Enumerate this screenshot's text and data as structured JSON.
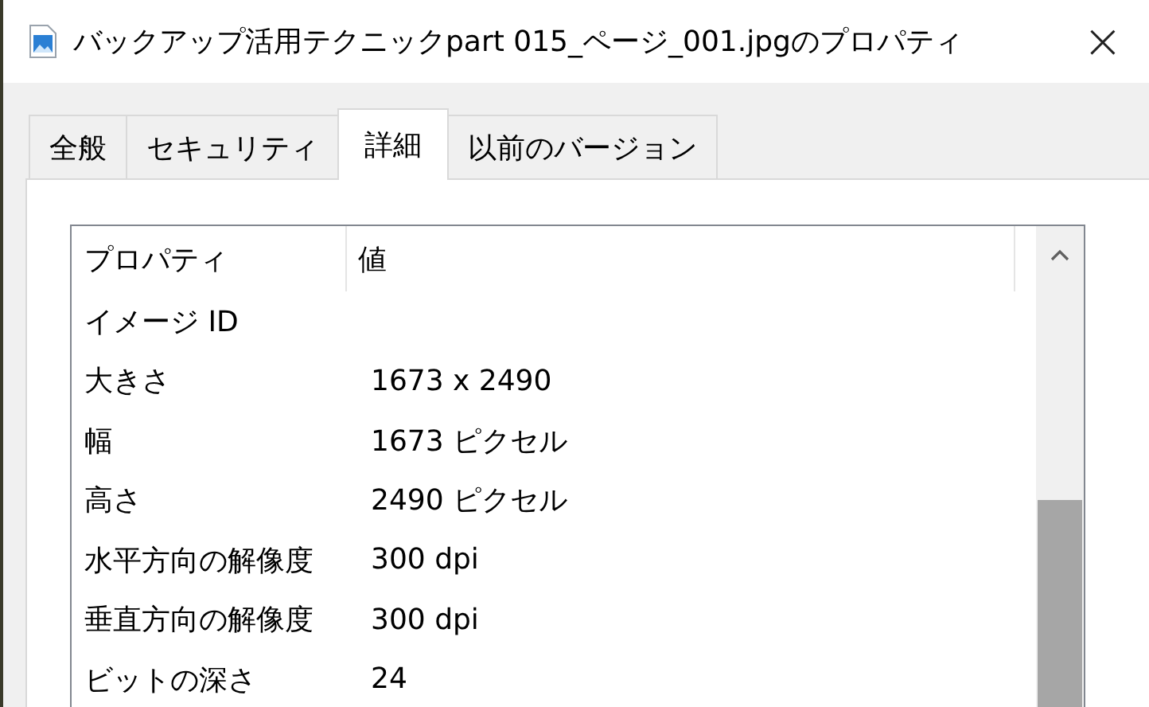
{
  "window": {
    "title": "バックアップ活用テクニックpart 015_ページ_001.jpgのプロパティ",
    "close": "×"
  },
  "tabs": [
    {
      "label": "全般",
      "selected": false
    },
    {
      "label": "セキュリティ",
      "selected": false
    },
    {
      "label": "詳細",
      "selected": true
    },
    {
      "label": "以前のバージョン",
      "selected": false
    }
  ],
  "table": {
    "columns": [
      "プロパティ",
      "値"
    ],
    "rows": [
      {
        "property": "イメージ ID",
        "value": ""
      },
      {
        "property": "大きさ",
        "value": "1673 x 2490"
      },
      {
        "property": "幅",
        "value": "1673 ピクセル"
      },
      {
        "property": "高さ",
        "value": "2490 ピクセル"
      },
      {
        "property": "水平方向の解像度",
        "value": "300 dpi"
      },
      {
        "property": "垂直方向の解像度",
        "value": "300 dpi"
      },
      {
        "property": "ビットの深さ",
        "value": "24"
      }
    ]
  }
}
